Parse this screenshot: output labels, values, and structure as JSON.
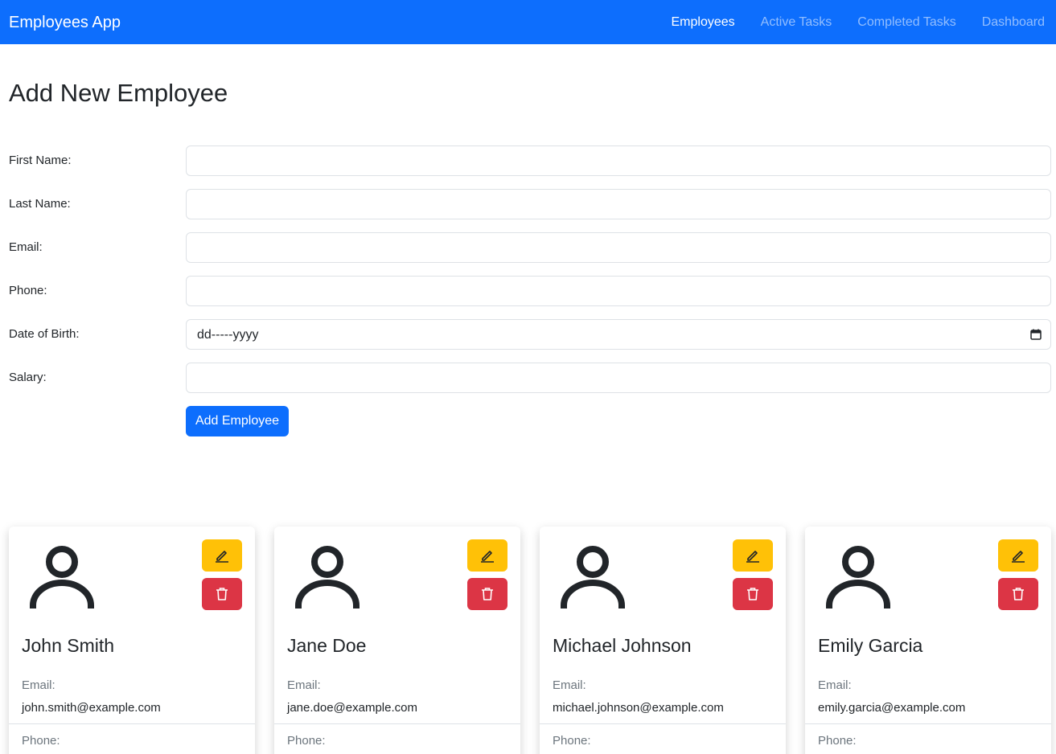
{
  "navbar": {
    "brand": "Employees App",
    "links": [
      {
        "label": "Employees",
        "active": true
      },
      {
        "label": "Active Tasks",
        "active": false
      },
      {
        "label": "Completed Tasks",
        "active": false
      },
      {
        "label": "Dashboard",
        "active": false
      }
    ]
  },
  "page": {
    "title": "Add New Employee"
  },
  "form": {
    "fields": [
      {
        "label": "First Name:",
        "value": ""
      },
      {
        "label": "Last Name:",
        "value": ""
      },
      {
        "label": "Email:",
        "value": ""
      },
      {
        "label": "Phone:",
        "value": ""
      },
      {
        "label": "Date of Birth:",
        "value": "dd-----yyyy"
      },
      {
        "label": "Salary:",
        "value": ""
      }
    ],
    "submit_label": "Add Employee"
  },
  "cards": [
    {
      "name": "John Smith",
      "email_label": "Email:",
      "email": "john.smith@example.com",
      "phone_label": "Phone:"
    },
    {
      "name": "Jane Doe",
      "email_label": "Email:",
      "email": "jane.doe@example.com",
      "phone_label": "Phone:"
    },
    {
      "name": "Michael Johnson",
      "email_label": "Email:",
      "email": "michael.johnson@example.com",
      "phone_label": "Phone:"
    },
    {
      "name": "Emily Garcia",
      "email_label": "Email:",
      "email": "emily.garcia@example.com",
      "phone_label": "Phone:"
    }
  ],
  "icons": {
    "avatar": "person-icon",
    "edit": "pencil-icon",
    "delete": "trash-icon",
    "calendar": "calendar-icon"
  },
  "colors": {
    "primary": "#0d6efd",
    "warning": "#ffc107",
    "danger": "#dc3545"
  }
}
